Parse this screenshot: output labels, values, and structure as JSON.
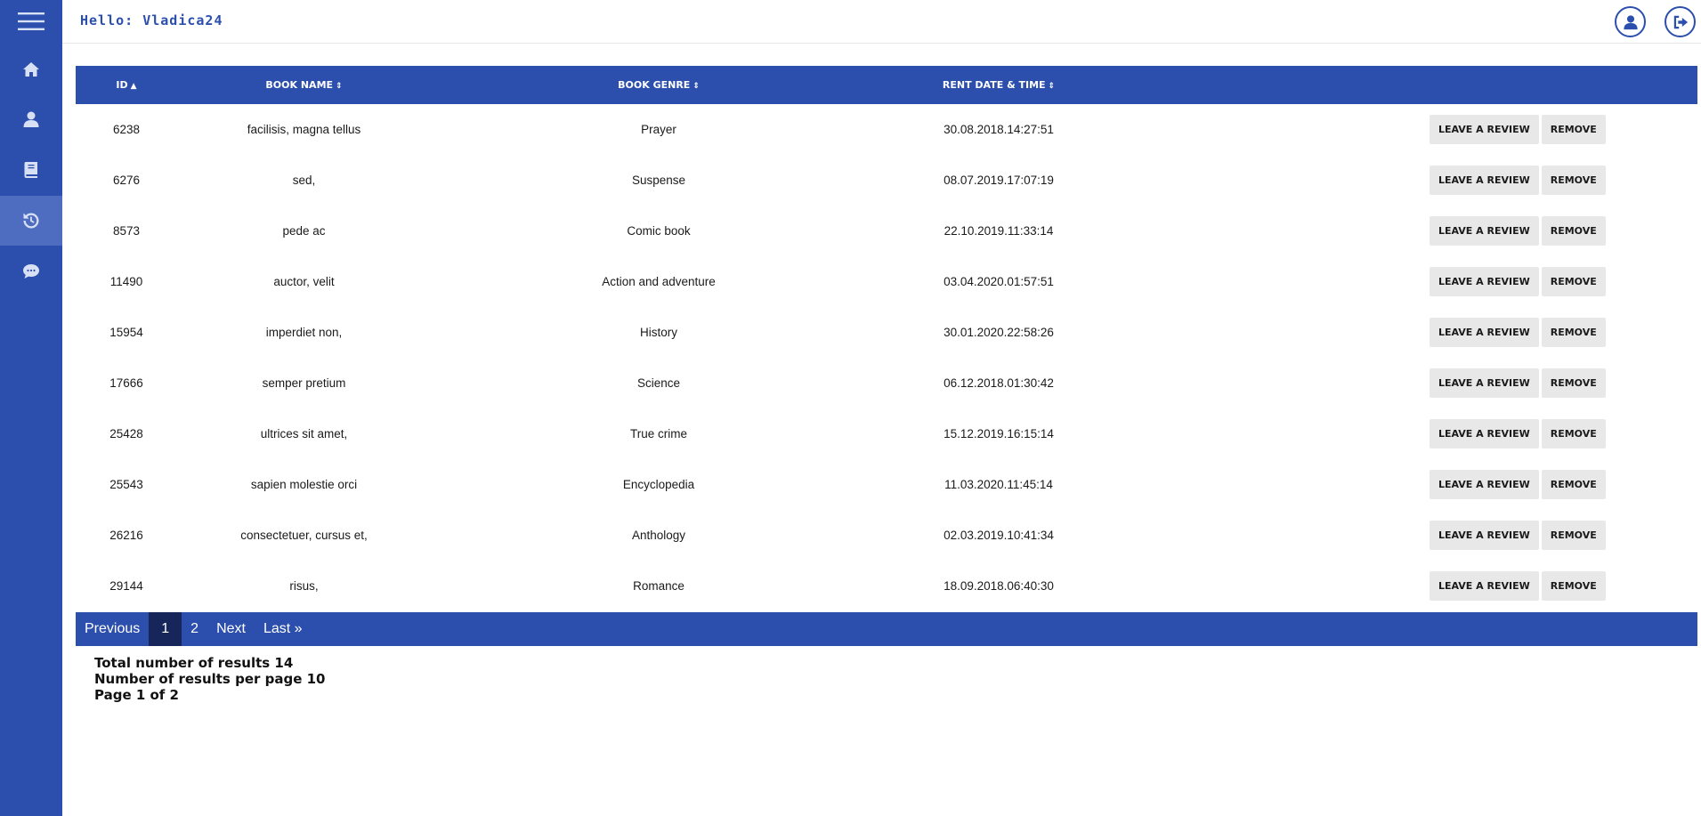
{
  "header": {
    "greeting": "Hello: Vladica24",
    "profile_icon": "user-circle-icon",
    "logout_icon": "logout-icon"
  },
  "sidebar": {
    "items": [
      {
        "icon": "menu-icon"
      },
      {
        "icon": "home-icon"
      },
      {
        "icon": "user-icon"
      },
      {
        "icon": "book-icon"
      },
      {
        "icon": "history-icon",
        "active": true
      },
      {
        "icon": "chat-icon"
      }
    ]
  },
  "table": {
    "columns": [
      "ID",
      "BOOK NAME",
      "BOOK GENRE",
      "RENT DATE & TIME"
    ],
    "sort_indicators": [
      "▲",
      "⇕",
      "⇕",
      "⇕"
    ],
    "action_labels": {
      "review": "LEAVE A REVIEW",
      "remove": "REMOVE"
    },
    "rows": [
      {
        "id": "6238",
        "name": "facilisis, magna tellus",
        "genre": "Prayer",
        "date": "30.08.2018.14:27:51"
      },
      {
        "id": "6276",
        "name": "sed,",
        "genre": "Suspense",
        "date": "08.07.2019.17:07:19"
      },
      {
        "id": "8573",
        "name": "pede ac",
        "genre": "Comic book",
        "date": "22.10.2019.11:33:14"
      },
      {
        "id": "11490",
        "name": "auctor, velit",
        "genre": "Action and adventure",
        "date": "03.04.2020.01:57:51"
      },
      {
        "id": "15954",
        "name": "imperdiet non,",
        "genre": "History",
        "date": "30.01.2020.22:58:26"
      },
      {
        "id": "17666",
        "name": "semper pretium",
        "genre": "Science",
        "date": "06.12.2018.01:30:42"
      },
      {
        "id": "25428",
        "name": "ultrices sit amet,",
        "genre": "True crime",
        "date": "15.12.2019.16:15:14"
      },
      {
        "id": "25543",
        "name": "sapien molestie orci",
        "genre": "Encyclopedia",
        "date": "11.03.2020.11:45:14"
      },
      {
        "id": "26216",
        "name": "consectetuer, cursus et,",
        "genre": "Anthology",
        "date": "02.03.2019.10:41:34"
      },
      {
        "id": "29144",
        "name": "risus,",
        "genre": "Romance",
        "date": "18.09.2018.06:40:30"
      }
    ]
  },
  "pagination": {
    "previous": "Previous",
    "pages": [
      "1",
      "2"
    ],
    "current": "1",
    "next": "Next",
    "last": "Last »"
  },
  "summary": {
    "total": "Total number of results 14",
    "per_page": "Number of results per page 10",
    "page": "Page 1 of 2"
  },
  "colors": {
    "primary": "#2c4fad",
    "sidebar_active": "#4e6cc0",
    "pager_current": "#16255a",
    "button_bg": "#e8e8e8"
  }
}
